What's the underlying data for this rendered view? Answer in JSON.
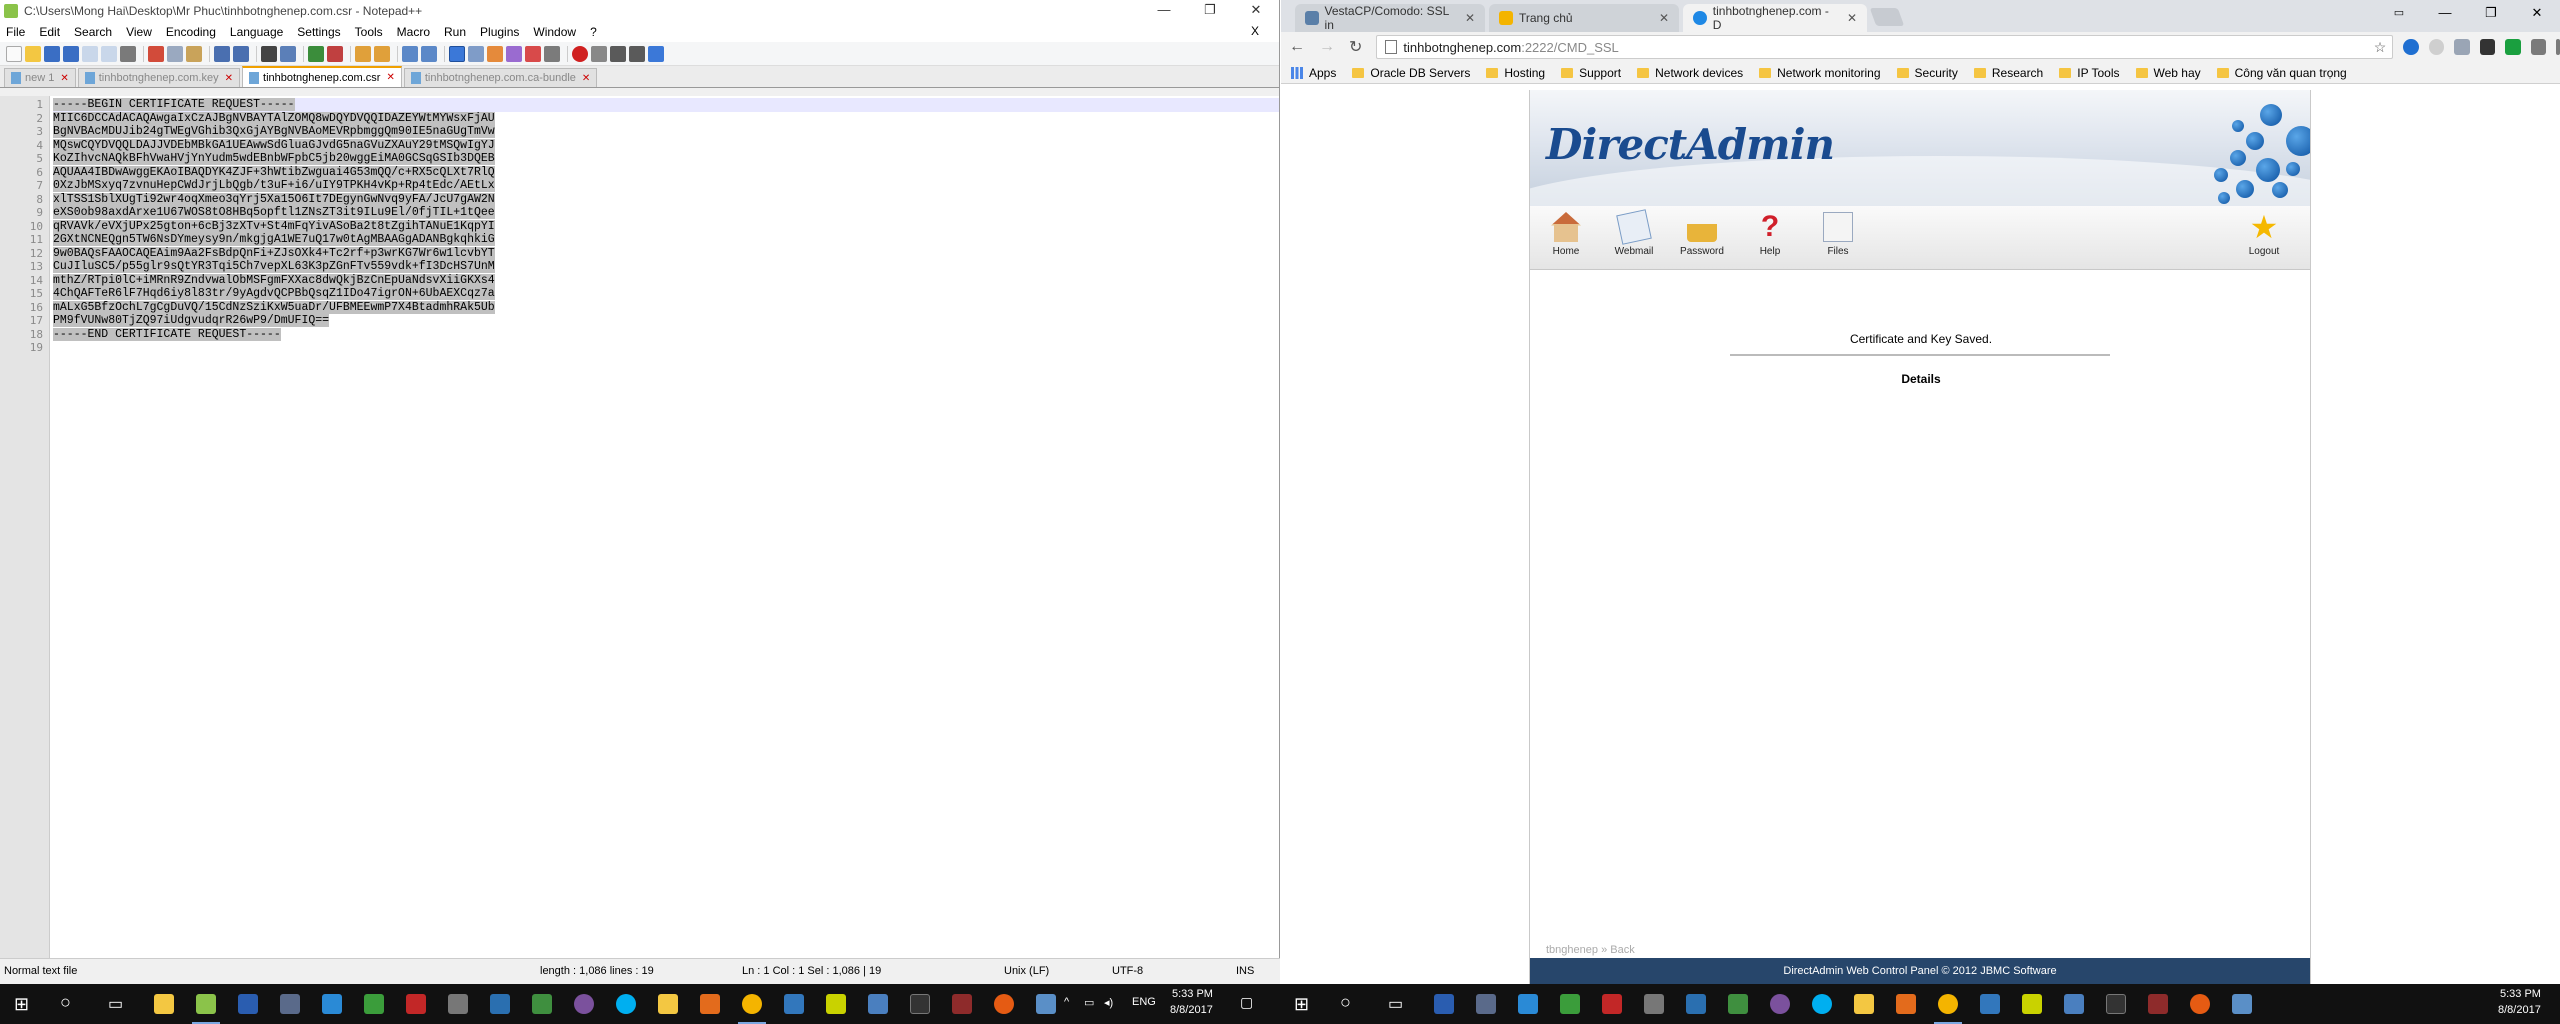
{
  "notepad": {
    "window_title": "C:\\Users\\Mong Hai\\Desktop\\Mr Phuc\\tinhbotnghenep.com.csr - Notepad++",
    "menu": [
      "File",
      "Edit",
      "Search",
      "View",
      "Encoding",
      "Language",
      "Settings",
      "Tools",
      "Macro",
      "Run",
      "Plugins",
      "Window",
      "?"
    ],
    "menu_close": "X",
    "tabs": [
      {
        "label": "new 1",
        "active": false
      },
      {
        "label": "tinhbotnghenep.com.key",
        "active": false
      },
      {
        "label": "tinhbotnghenep.com.csr",
        "active": true
      },
      {
        "label": "tinhbotnghenep.com.ca-bundle",
        "active": false
      }
    ],
    "line_numbers": [
      "1",
      "2",
      "3",
      "4",
      "5",
      "6",
      "7",
      "8",
      "9",
      "10",
      "11",
      "12",
      "13",
      "14",
      "15",
      "16",
      "17",
      "18",
      "19"
    ],
    "lines": [
      "-----BEGIN CERTIFICATE REQUEST-----",
      "MIIC6DCCAdACAQAwgaIxCzAJBgNVBAYTAlZOMQ8wDQYDVQQIDAZEYWtMYWsxFjAU",
      "BgNVBAcMDUJib24gTWEgVGhib3QxGjAYBgNVBAoMEVRpbmggQm90IE5naGUgTmVw",
      "MQswCQYDVQQLDAJJVDEbMBkGA1UEAwwSdGluaGJvdG5naGVuZXAuY29tMSQwIgYJ",
      "KoZIhvcNAQkBFhVwaHVjYnYudm5wdEBnbWFpbC5jb20wggEiMA0GCSqGSIb3DQEB",
      "AQUAA4IBDwAwggEKAoIBAQDYK4ZJF+3hWtibZwguai4G53mQQ/c+RX5cQLXt7RlQ",
      "0XzJbMSxyq7zvnuHepCWdJrjLbQgb/t3uF+i6/uIY9TPKH4vKp+Rp4tEdc/AEtLx",
      "xlTSS1SblXUgTi92wr4oqXmeo3qYrj5Xa15O6It7DEgynGwNvq9yFA/JcU7gAW2N",
      "eXS0ob98axdArxe1U67WOS8tO8HBq5opftl1ZNsZT3it9ILu9El/0fjTIL+1tQee",
      "qRVAVk/eVXjUPx25gton+6cBj3zXTv+St4mFqYivASoBa2t8tZgihTANuE1KqpYI",
      "2GXtNCNEQgn5TW6NsDYmeysy9n/mkgjgA1WE7uQ17w0tAgMBAAGgADANBgkqhkiG",
      "9w0BAQsFAAOCAQEAim9Aa2FsBdpQnFi+ZJsOXk4+Tc2rf+p3wrKG7Wr6w1lcvbYT",
      "CuJIluSC5/p55glr9sQtYR3Tqi5Ch7vepXL63K3pZGnFTv559vdk+fI3DcHS7UnM",
      "mthZ/RTpi0lC+iMRnR9ZndvwalObMSFgmFXXac8dwQkjBzCnEpUaNdsvXiiGKXs4",
      "4ChQAFTeR6lF7Hqd6iy8l83tr/9yAgdvQCPBbQsqZ1IDo47igrON+6UbAEXCqz7a",
      "mALxG5BfzOchL7gCgDuVQ/15CdNzSziKxW5uaDr/UFBMEEwmP7X4BtadmhRAk5Ub",
      "PM9fVUNw80TjZQ97iUdgvudqrR26wP9/DmUFIQ==",
      "-----END CERTIFICATE REQUEST-----",
      ""
    ],
    "status": {
      "file_type": "Normal text file",
      "length": "length : 1,086    lines : 19",
      "position": "Ln : 1    Col : 1    Sel : 1,086 | 19",
      "eol": "Unix (LF)",
      "encoding": "UTF-8",
      "mode": "INS"
    }
  },
  "chrome": {
    "tabs": [
      {
        "label": "VestaCP/Comodo: SSL in",
        "active": false,
        "favicon_color": "#5a7fa8"
      },
      {
        "label": "Trang chủ",
        "active": false,
        "favicon_color": "#f4b400"
      },
      {
        "label": "tinhbotnghenep.com - D",
        "active": true,
        "favicon_color": "#1e88e5"
      }
    ],
    "url_host": "tinhbotnghenep.com",
    "url_rest": ":2222/CMD_SSL",
    "bookmarks": [
      "Apps",
      "Oracle DB Servers",
      "Hosting",
      "Support",
      "Network devices",
      "Network monitoring",
      "Security",
      "Research",
      "IP Tools",
      "Web hay",
      "Công văn quan trọng"
    ]
  },
  "directadmin": {
    "logo": "DirectAdmin",
    "nav": [
      {
        "label": "Home",
        "icon": "home-icon"
      },
      {
        "label": "Webmail",
        "icon": "webmail-icon"
      },
      {
        "label": "Password",
        "icon": "lock-icon"
      },
      {
        "label": "Help",
        "icon": "help-icon"
      },
      {
        "label": "Files",
        "icon": "files-icon"
      },
      {
        "label": "Logout",
        "icon": "star-icon"
      }
    ],
    "message": "Certificate and Key Saved.",
    "details": "Details",
    "breadcrumb_user": "tbnghenep",
    "breadcrumb_sep": "»",
    "breadcrumb_back": "Back",
    "footer": "DirectAdmin Web Control Panel © 2012 JBMC Software"
  },
  "taskbar": {
    "left_clock_time": "5:33 PM",
    "left_clock_date": "8/8/2017",
    "left_lang": "ENG",
    "right_clock_time": "5:33 PM",
    "right_clock_date": "8/8/2017"
  }
}
